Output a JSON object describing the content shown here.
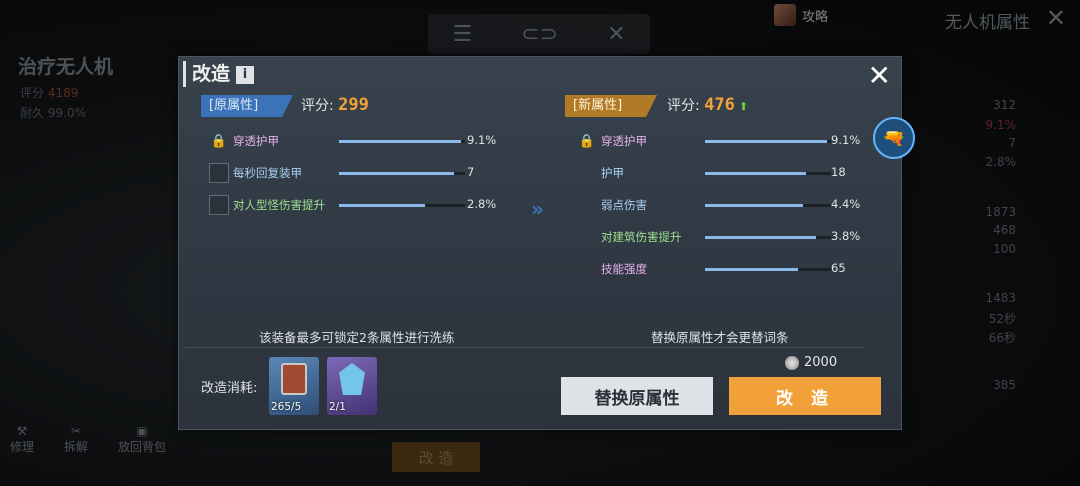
{
  "topbar": {
    "icons": [
      "list-icon",
      "link-icon",
      "close-icon"
    ]
  },
  "guide": {
    "label": "攻略"
  },
  "right_title": "无人机属性",
  "left_title": "治疗无人机",
  "left_stats": {
    "score_label": "评分",
    "score_value": "4189",
    "durability_label": "耐久",
    "durability_value": "99.0%"
  },
  "bottom_actions": [
    {
      "label": "修理"
    },
    {
      "label": "拆解"
    },
    {
      "label": "放回背包"
    }
  ],
  "ghost_button": "改 造",
  "right_values": [
    "312",
    "9.1%",
    "7",
    "2.8%",
    "1873",
    "468",
    "100",
    "1483",
    "52秒",
    "66秒",
    "385"
  ],
  "dialog": {
    "title": "改造",
    "info_label": "i",
    "old": {
      "tag": "[原属性]",
      "score_label": "评分:",
      "score": "299"
    },
    "new": {
      "tag": "[新属性]",
      "score_label": "评分:",
      "score": "476",
      "score_arrow": "⬆"
    },
    "old_attrs": [
      {
        "name": "穿透护甲",
        "value": "9.1%",
        "fill": 0.97,
        "locked": true,
        "color": "#e3b0ea"
      },
      {
        "name": "每秒回复装甲",
        "value": "7",
        "fill": 0.91,
        "locked": false,
        "color": "#a6cff5"
      },
      {
        "name": "对人型怪伤害提升",
        "value": "2.8%",
        "fill": 0.68,
        "locked": false,
        "color": "#9fe08f"
      }
    ],
    "new_attrs": [
      {
        "name": "穿透护甲",
        "value": "9.1%",
        "fill": 0.97,
        "locked": true,
        "color": "#e3b0ea"
      },
      {
        "name": "护甲",
        "value": "18",
        "fill": 0.8,
        "locked": false,
        "color": "#a6cff5"
      },
      {
        "name": "弱点伤害",
        "value": "4.4%",
        "fill": 0.78,
        "locked": false,
        "color": "#a6cff5"
      },
      {
        "name": "对建筑伤害提升",
        "value": "3.8%",
        "fill": 0.88,
        "locked": false,
        "color": "#9fe08f"
      },
      {
        "name": "技能强度",
        "value": "65",
        "fill": 0.74,
        "locked": false,
        "color": "#e3b0ea"
      }
    ],
    "lock_note": "该装备最多可锁定2条属性进行洗练",
    "replace_note": "替换原属性才会更替词条",
    "cost_label": "改造消耗:",
    "cost_items": [
      {
        "count": "265/5"
      },
      {
        "count": "2/1"
      }
    ],
    "coin_amount": "2000",
    "replace_button": "替换原属性",
    "refit_button": "改 造",
    "colors": {
      "accent": "#f2a13a",
      "blue_tag": "#3c73b8",
      "gold_tag": "#b07a26",
      "bar": "#8ab9ea"
    }
  }
}
